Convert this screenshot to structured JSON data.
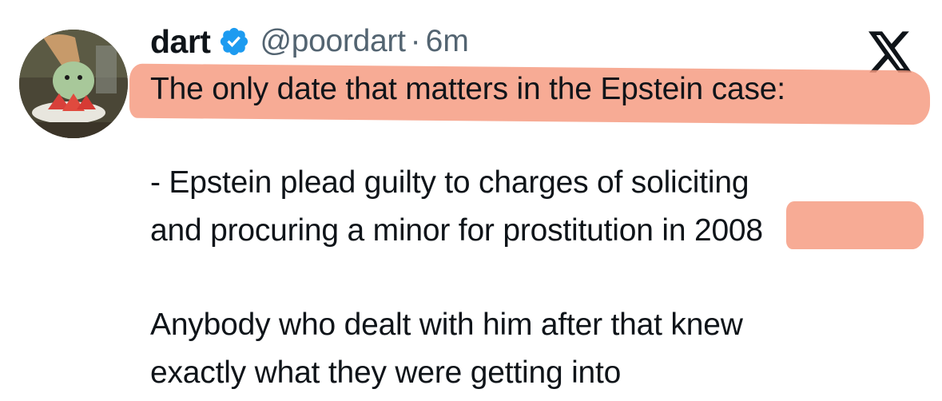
{
  "author": {
    "name": "dart",
    "handle": "@poordart",
    "separator": "·",
    "time": "6m",
    "verified": true,
    "avatar_icon": "cartoon-blob-eating-watermelon-avatar"
  },
  "platform_icon": "x-logo-icon",
  "tweet": {
    "line1": "The only date that matters in the Epstein case:",
    "para2_line1": "- Epstein plead guilty to charges of soliciting",
    "para2_line2": "and procuring a minor for prostitution in 2008",
    "para3_line1": "Anybody who dealt with him after that knew",
    "para3_line2": "exactly what they were getting into"
  },
  "colors": {
    "highlight": "#f5987e",
    "verified_badge": "#1d9bf0",
    "secondary_text": "#536471",
    "primary_text": "#0f1419"
  }
}
